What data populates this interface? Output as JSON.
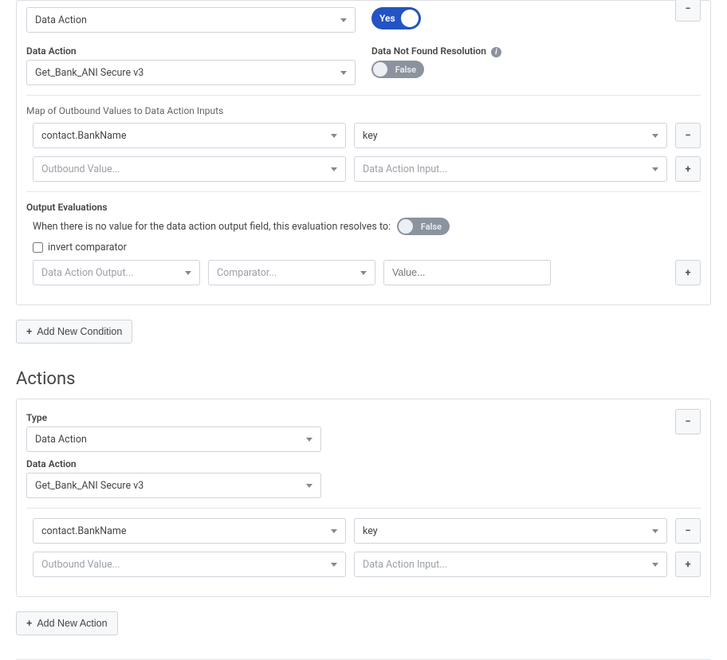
{
  "condition": {
    "type_value": "Data Action",
    "yes_toggle": "Yes",
    "data_action_label": "Data Action",
    "data_action_value": "Get_Bank_ANI Secure v3",
    "data_not_found_label": "Data Not Found Resolution",
    "data_not_found_toggle": "False",
    "map_label": "Map of Outbound Values to Data Action Inputs",
    "map_rows": [
      {
        "outbound": "contact.BankName",
        "input": "key",
        "placeholder": false
      },
      {
        "outbound": "Outbound Value...",
        "input": "Data Action Input...",
        "placeholder": true
      }
    ],
    "output_eval_label": "Output Evaluations",
    "output_eval_text": "When there is no value for the data action output field, this evaluation resolves to:",
    "output_eval_toggle": "False",
    "invert_label": "invert comparator",
    "output_placeholder": "Data Action Output...",
    "comparator_placeholder": "Comparator...",
    "value_placeholder": "Value..."
  },
  "add_condition_btn": "Add New Condition",
  "actions_heading": "Actions",
  "action": {
    "type_label": "Type",
    "type_value": "Data Action",
    "data_action_label": "Data Action",
    "data_action_value": "Get_Bank_ANI Secure v3",
    "map_rows": [
      {
        "outbound": "contact.BankName",
        "input": "key",
        "placeholder": false
      },
      {
        "outbound": "Outbound Value...",
        "input": "Data Action Input...",
        "placeholder": true
      }
    ]
  },
  "add_action_btn": "Add New Action",
  "icons": {
    "minus": "−",
    "plus": "+"
  }
}
